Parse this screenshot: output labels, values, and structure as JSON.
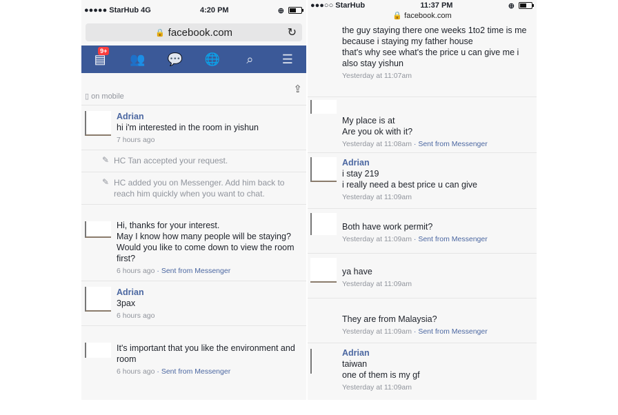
{
  "left": {
    "status": {
      "carrier": "●●●●● StarHub  4G",
      "time": "4:20 PM"
    },
    "url": "facebook.com",
    "nav": {
      "badge": "9+"
    },
    "on_mobile": "on mobile",
    "messages": [
      {
        "sender": "Adrian",
        "lines": [
          "hi i'm interested in the room in yishun"
        ],
        "time": "7 hours ago",
        "via": ""
      },
      {
        "system": true,
        "text": "HC Tan accepted your request."
      },
      {
        "system": true,
        "text": "HC added you on Messenger. Add him back to reach him quickly when you want to chat."
      },
      {
        "sender": "",
        "lines": [
          "Hi, thanks for your interest.",
          "May I know how many people will be staying?",
          "Would you like to come down to view the room first?"
        ],
        "time": "6 hours ago",
        "via": "Sent from Messenger"
      },
      {
        "sender": "Adrian",
        "lines": [
          "3pax"
        ],
        "time": "6 hours ago",
        "via": ""
      },
      {
        "sender": "",
        "lines": [
          "It's important that you like the environment and room"
        ],
        "time": "6 hours ago",
        "via": "Sent from Messenger"
      }
    ]
  },
  "right": {
    "status": {
      "carrier": "●●●○○ StarHub",
      "time": "11:37 PM"
    },
    "url": "facebook.com",
    "messages": [
      {
        "sender": "",
        "lines": [
          "the guy staying there one weeks 1to2 time is me",
          "because i staying my father house",
          "that's why see what's the price u can give me i also stay yishun"
        ],
        "time": "Yesterday at 11:07am",
        "via": ""
      },
      {
        "sender": "",
        "lines": [
          "My place is at",
          "Are you ok with it?"
        ],
        "time": "Yesterday at 11:08am",
        "via": "Sent from Messenger"
      },
      {
        "sender": "Adrian",
        "lines": [
          "i stay 219",
          "i really need a best price u can give"
        ],
        "time": "Yesterday at 11:09am",
        "via": ""
      },
      {
        "sender": "",
        "lines": [
          "Both have work permit?"
        ],
        "time": "Yesterday at 11:09am",
        "via": "Sent from Messenger"
      },
      {
        "sender": "",
        "lines": [
          "ya have"
        ],
        "time": "Yesterday at 11:09am",
        "via": ""
      },
      {
        "sender": "",
        "lines": [
          "They are from Malaysia?"
        ],
        "time": "Yesterday at 11:09am",
        "via": "Sent from Messenger"
      },
      {
        "sender": "Adrian",
        "lines": [
          "taiwan",
          "one of them is my gf"
        ],
        "time": "Yesterday at 11:09am",
        "via": ""
      }
    ]
  }
}
